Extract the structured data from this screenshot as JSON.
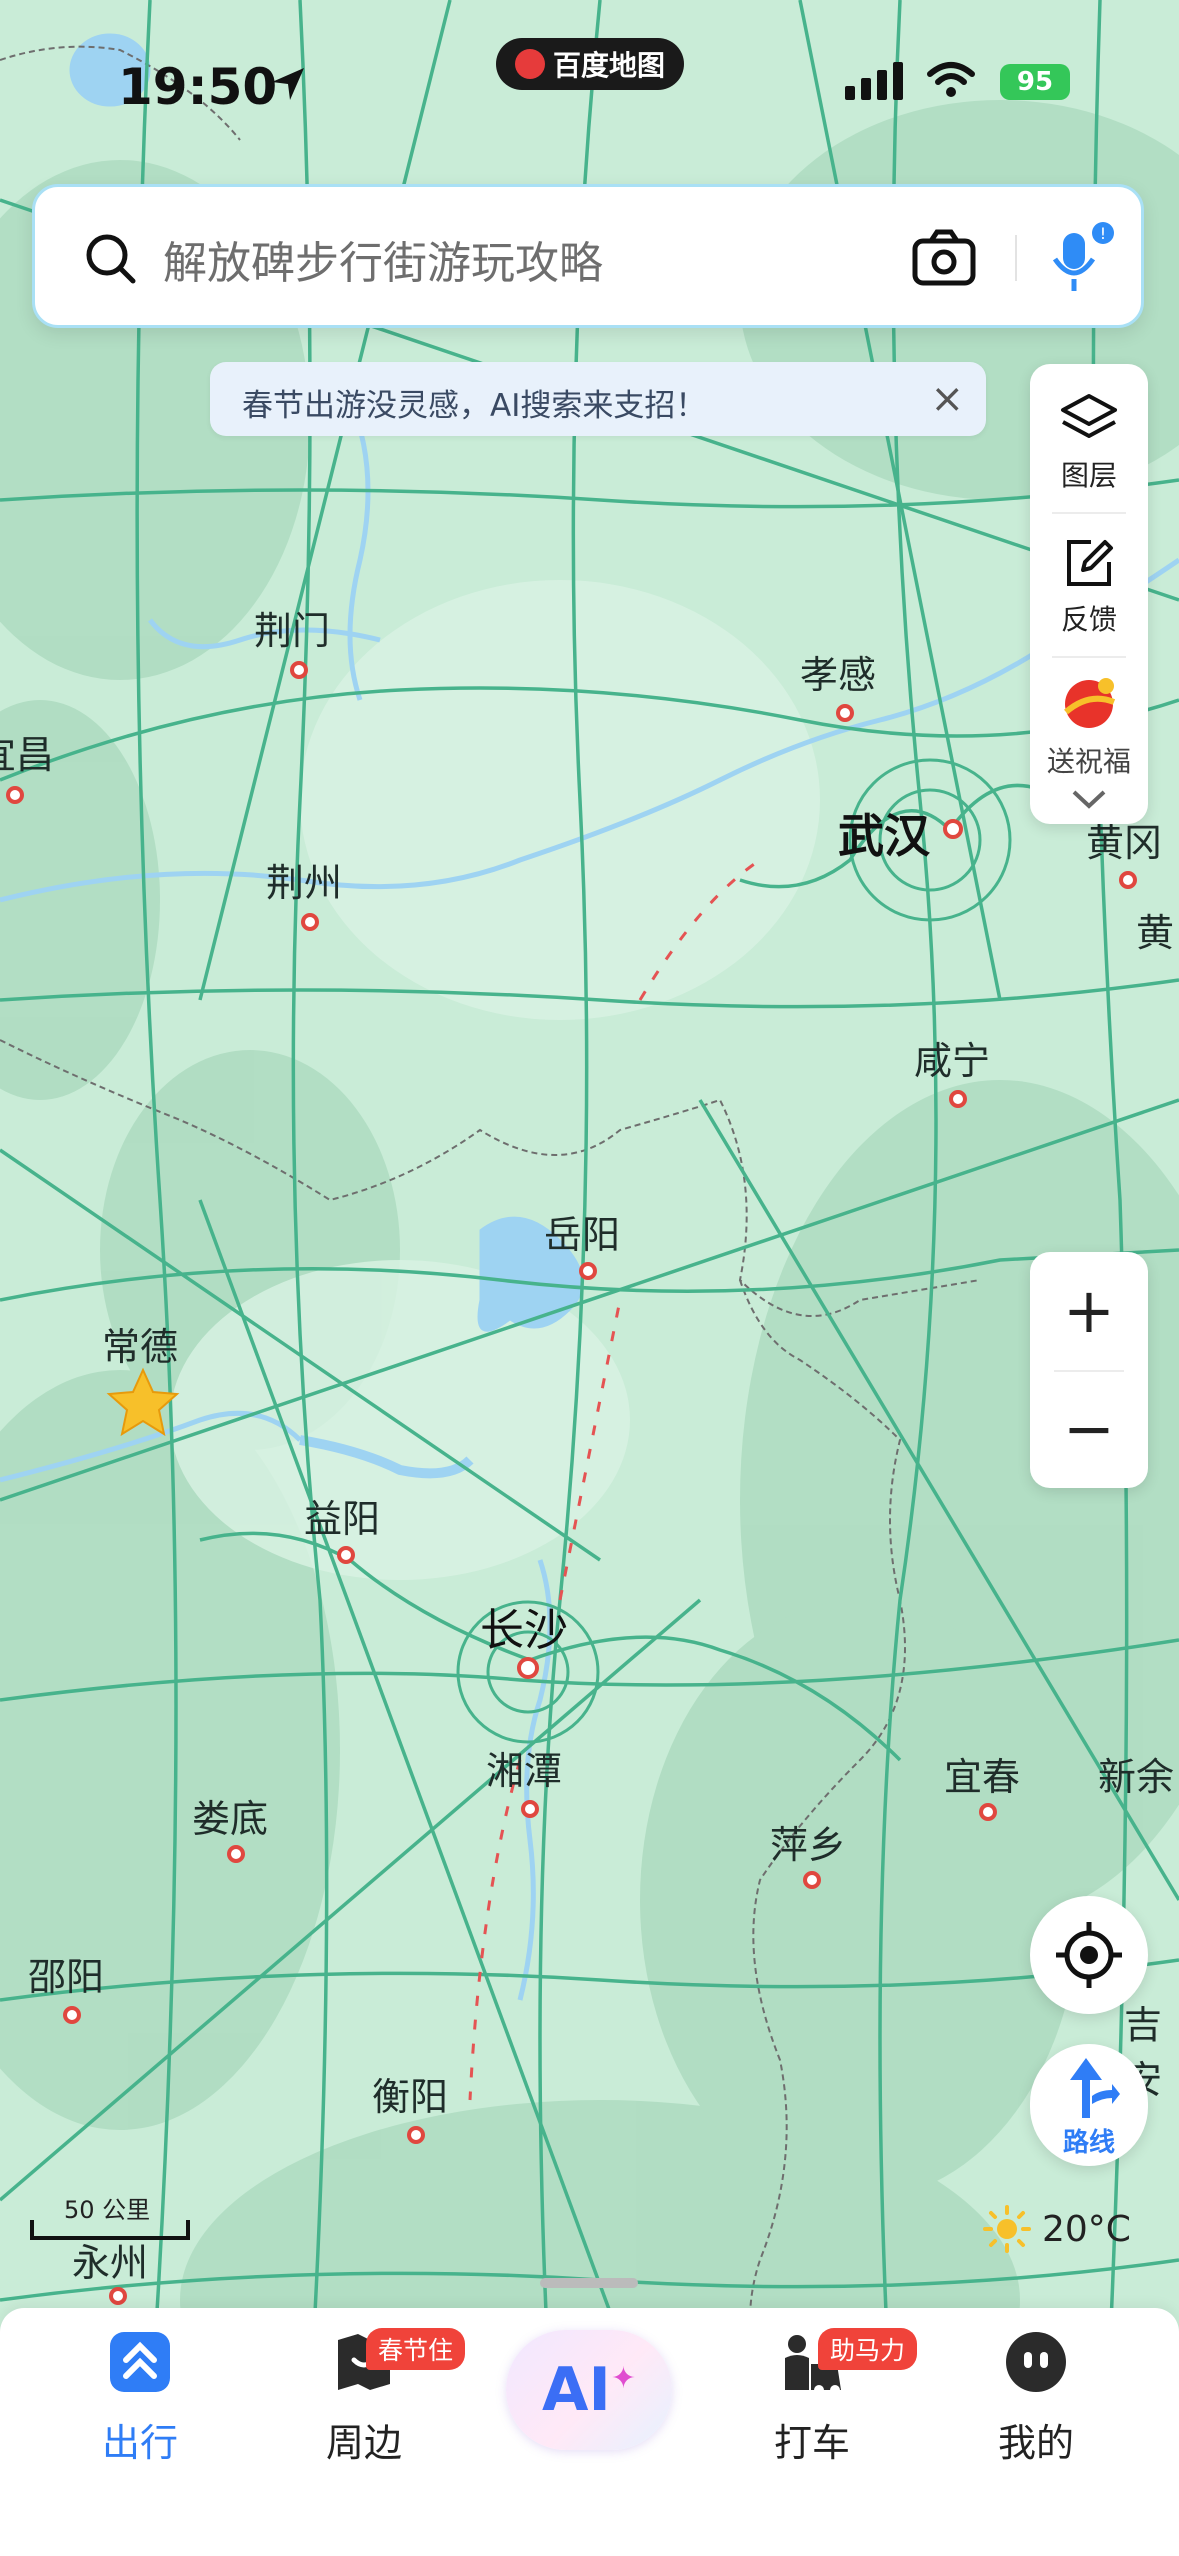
{
  "status_bar": {
    "time": "19:50",
    "app_name": "百度地图",
    "battery": "95"
  },
  "search": {
    "placeholder": "解放碑步行街游玩攻略"
  },
  "tip": {
    "text": "春节出游没灵感，AI搜索来支招！",
    "close": "×"
  },
  "tools": {
    "layers": "图层",
    "feedback": "反馈",
    "blessing": "送祝福"
  },
  "zoom": {
    "in": "+",
    "out": "−"
  },
  "route": {
    "label": "路线"
  },
  "scale": {
    "label": "50 公里"
  },
  "weather": {
    "temp": "20°C"
  },
  "cities": {
    "jingmen": "荆门",
    "xiaogan": "孝感",
    "yichang": "宜昌",
    "wuhan": "武汉",
    "huanggang": "黄冈",
    "huangshi": "黄",
    "jingzhou": "荆州",
    "xianning": "咸宁",
    "yueyang": "岳阳",
    "changde": "常德",
    "yiyang": "益阳",
    "changsha": "长沙",
    "xiangtan": "湘潭",
    "loudi": "娄底",
    "pingxiang": "萍乡",
    "yichun": "宜春",
    "xinyu": "新余",
    "shaoyang": "邵阳",
    "hengyang": "衡阳",
    "yongzhou": "永州",
    "jian": "吉安"
  },
  "nav": {
    "travel": "出行",
    "nearby": "周边",
    "nearby_badge": "春节住",
    "ai": "AI",
    "taxi": "打车",
    "taxi_badge": "助马力",
    "mine": "我的"
  }
}
